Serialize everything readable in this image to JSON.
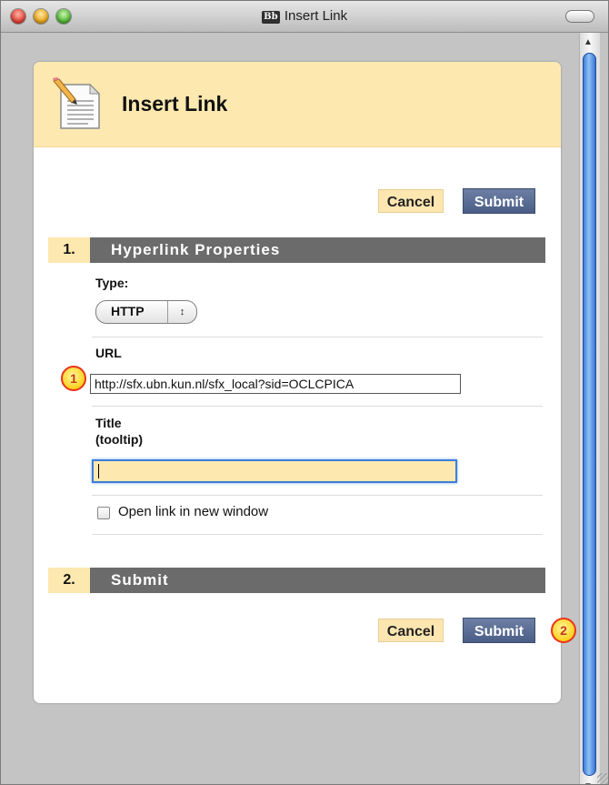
{
  "window": {
    "title": "Insert Link",
    "app_icon_text": "Bb"
  },
  "header": {
    "title": "Insert Link",
    "icon": "document-pencil-icon"
  },
  "top_actions": {
    "cancel_label": "Cancel",
    "submit_label": "Submit"
  },
  "section1": {
    "number": "1.",
    "title": "Hyperlink Properties",
    "type_label": "Type:",
    "type_value": "HTTP",
    "url_label": "URL",
    "url_value": "http://sfx.ubn.kun.nl/sfx_local?sid=OCLCPICA",
    "title_label_line1": "Title",
    "title_label_line2": "(tooltip)",
    "title_value": "",
    "open_new_window_label": "Open link in new window",
    "open_new_window_checked": false
  },
  "section2": {
    "number": "2.",
    "title": "Submit"
  },
  "bottom_actions": {
    "cancel_label": "Cancel",
    "submit_label": "Submit"
  },
  "callouts": [
    "1",
    "2"
  ],
  "colors": {
    "header_bg": "#fde8b0",
    "section_bar": "#6b6b6b",
    "submit_bg": "#4a5d86"
  }
}
